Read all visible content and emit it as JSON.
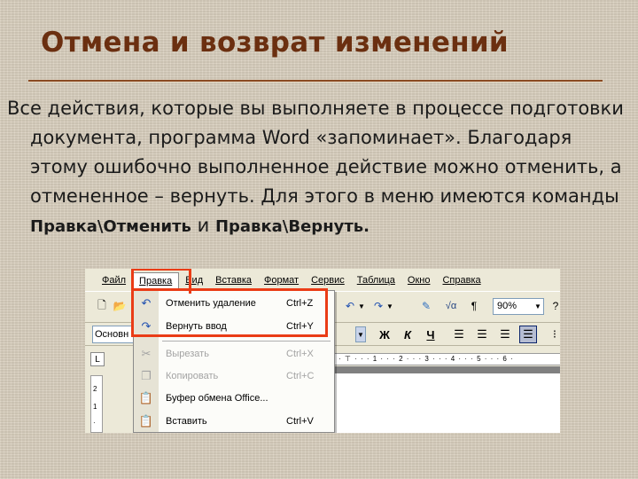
{
  "slide": {
    "title": "Отмена и возврат изменений",
    "body_text": "Все действия, которые вы выполняете в процессе подготовки документа, программа Word «запоминает». Благодаря этому ошибочно выполненное действие можно отменить, а отмененное – вернуть. Для этого в меню имеются команды ",
    "cmd_undo": "Правка\\Отменить",
    "conjunction": " и ",
    "cmd_redo": "Правка\\Вернуть."
  },
  "word": {
    "menubar": [
      "Файл",
      "Правка",
      "Вид",
      "Вставка",
      "Формат",
      "Сервис",
      "Таблица",
      "Окно",
      "Справка"
    ],
    "open_menu": "Правка",
    "edit_menu": {
      "items": [
        {
          "label": "Отменить удаление",
          "shortcut": "Ctrl+Z",
          "icon": "undo-icon",
          "enabled": true
        },
        {
          "label": "Вернуть ввод",
          "shortcut": "Ctrl+Y",
          "icon": "redo-icon",
          "enabled": true
        },
        {
          "label": "Вырезать",
          "shortcut": "Ctrl+X",
          "icon": "scissors-icon",
          "enabled": false
        },
        {
          "label": "Копировать",
          "shortcut": "Ctrl+C",
          "icon": "copy-icon",
          "enabled": false
        },
        {
          "label": "Буфер обмена Office...",
          "shortcut": "",
          "icon": "clipboard-icon",
          "enabled": true
        },
        {
          "label": "Вставить",
          "shortcut": "Ctrl+V",
          "icon": "paste-icon",
          "enabled": true
        }
      ]
    },
    "style_value": "Основн",
    "zoom_value": "90%",
    "format_buttons": {
      "bold": "Ж",
      "italic": "К",
      "underline": "Ч"
    },
    "ruler_text": "· ⊤ · · · 1 · · · 2 · · · 3 · · · 4 · · · 5 · · · 6 ·",
    "vruler_labels": [
      "2",
      "1",
      "·"
    ]
  },
  "colors": {
    "title": "#6b2f10",
    "highlight": "#ea3c16",
    "background": "#d9cfbe"
  }
}
